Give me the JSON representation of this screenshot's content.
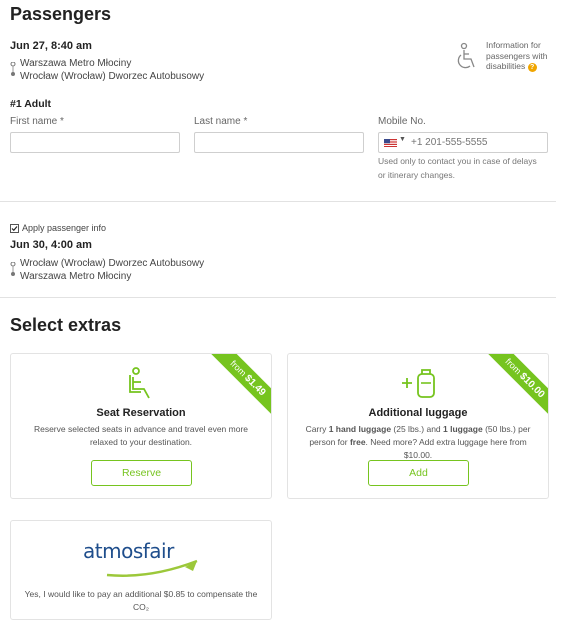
{
  "passengers": {
    "title": "Passengers",
    "outbound": {
      "datetime": "Jun 27, 8:40 am",
      "from": "Warszawa Metro Młociny",
      "to": "Wrocław (Wrocław) Dworzec Autobusowy"
    },
    "disabilities": {
      "text": "Information for passengers with disabilities",
      "help_glyph": "?"
    },
    "adult_label": "#1 Adult",
    "first_name_label": "First name *",
    "last_name_label": "Last name *",
    "mobile_label": "Mobile No.",
    "mobile_placeholder": "+1 201-555-5555",
    "mobile_note": "Used only to contact you in case of delays or itinerary changes.",
    "apply_info_label": "Apply passenger info",
    "return": {
      "datetime": "Jun 30, 4:00 am",
      "from": "Wrocław (Wrocław) Dworzec Autobusowy",
      "to": "Warszawa Metro Młociny"
    }
  },
  "extras": {
    "title": "Select extras",
    "seat": {
      "ribbon_prefix": "from",
      "ribbon_price": "$1.49",
      "title": "Seat Reservation",
      "description": "Reserve selected seats in advance and travel even more relaxed to your destination.",
      "button": "Reserve",
      "icon": "seat-icon"
    },
    "luggage": {
      "ribbon_prefix": "from",
      "ribbon_price": "$10.00",
      "title": "Additional luggage",
      "desc_1": "Carry ",
      "desc_hand": "1 hand luggage",
      "desc_2": " (25 lbs.) and ",
      "desc_big": "1 luggage",
      "desc_3": " (50 lbs.) per person for ",
      "desc_free": "free",
      "desc_4": ". Need more? Add extra luggage here from $10.00.",
      "button": "Add",
      "icon": "luggage-icon"
    },
    "atmosfair": {
      "logo_text": "atmosfair",
      "description": "Yes, I would like to pay an additional $0.85 to compensate the CO₂"
    }
  },
  "colors": {
    "accent": "#76c41f",
    "text": "#333333",
    "logo_blue": "#1f4e8c",
    "help_icon": "#f0a500"
  }
}
